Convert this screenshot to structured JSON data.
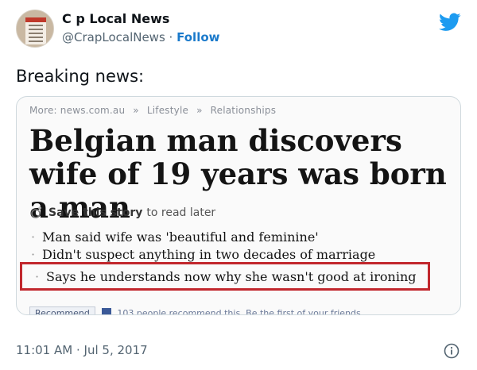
{
  "author": {
    "name": "C  p Local News",
    "handle": "@CrapLocalNews",
    "separator": "·",
    "follow_label": "Follow"
  },
  "tweet": {
    "text": "Breaking news:",
    "time": "11:01 AM",
    "date_separator": "·",
    "date": "Jul 5, 2017"
  },
  "media": {
    "breadcrumbs": [
      "More: news.com.au",
      "»",
      "Lifestyle",
      "»",
      "Relationships"
    ],
    "headline": "Belgian man discovers wife of 19 years was born a man",
    "save_bold": "Save this story",
    "save_rest": "to read later",
    "bullets": [
      "Man said wife was 'beautiful and feminine'",
      "Didn't suspect anything in two decades of marriage"
    ],
    "highlighted_bullet": "Says he understands now why she wasn't good at ironing",
    "recommend_label": "Recommend",
    "recommend_count_text": "103 people recommend this. Be the first of your friends."
  },
  "icons": {
    "brand": "twitter-bird-icon",
    "info": "info-icon",
    "save": "save-story-icon"
  },
  "colors": {
    "twitter_blue": "#1d9bf0",
    "follow_blue": "#1b7acb",
    "highlight_red": "#c1272d",
    "muted_text": "#536471"
  }
}
